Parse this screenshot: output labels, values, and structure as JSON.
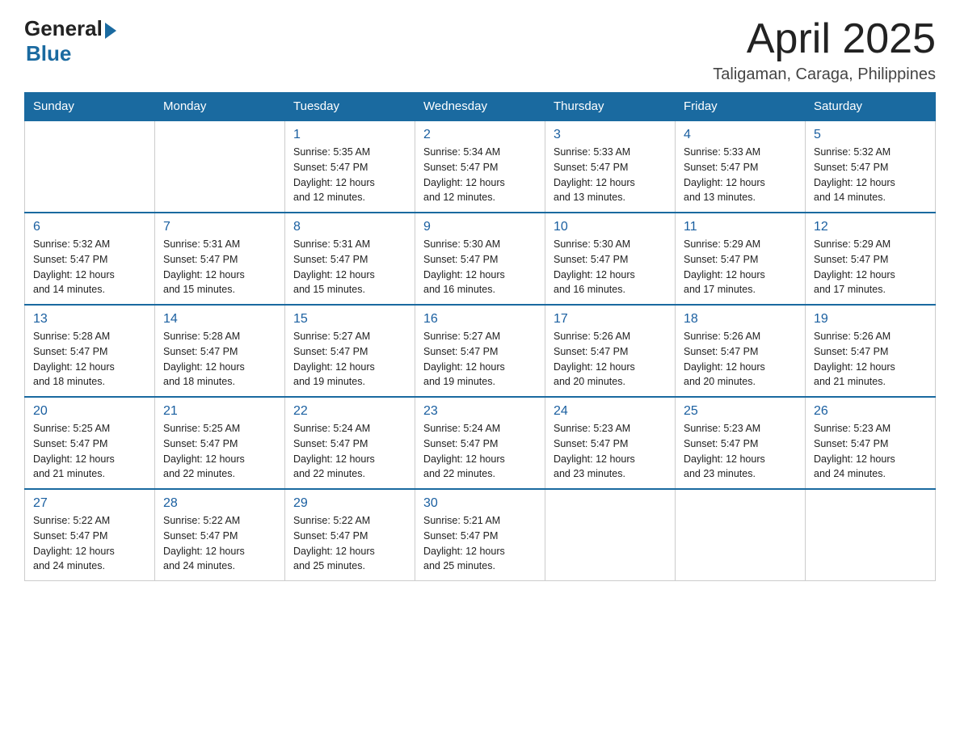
{
  "logo": {
    "general": "General",
    "blue": "Blue",
    "line2": "Blue"
  },
  "header": {
    "title": "April 2025",
    "location": "Taligaman, Caraga, Philippines"
  },
  "days_of_week": [
    "Sunday",
    "Monday",
    "Tuesday",
    "Wednesday",
    "Thursday",
    "Friday",
    "Saturday"
  ],
  "weeks": [
    [
      {
        "day": "",
        "info": ""
      },
      {
        "day": "",
        "info": ""
      },
      {
        "day": "1",
        "info": "Sunrise: 5:35 AM\nSunset: 5:47 PM\nDaylight: 12 hours\nand 12 minutes."
      },
      {
        "day": "2",
        "info": "Sunrise: 5:34 AM\nSunset: 5:47 PM\nDaylight: 12 hours\nand 12 minutes."
      },
      {
        "day": "3",
        "info": "Sunrise: 5:33 AM\nSunset: 5:47 PM\nDaylight: 12 hours\nand 13 minutes."
      },
      {
        "day": "4",
        "info": "Sunrise: 5:33 AM\nSunset: 5:47 PM\nDaylight: 12 hours\nand 13 minutes."
      },
      {
        "day": "5",
        "info": "Sunrise: 5:32 AM\nSunset: 5:47 PM\nDaylight: 12 hours\nand 14 minutes."
      }
    ],
    [
      {
        "day": "6",
        "info": "Sunrise: 5:32 AM\nSunset: 5:47 PM\nDaylight: 12 hours\nand 14 minutes."
      },
      {
        "day": "7",
        "info": "Sunrise: 5:31 AM\nSunset: 5:47 PM\nDaylight: 12 hours\nand 15 minutes."
      },
      {
        "day": "8",
        "info": "Sunrise: 5:31 AM\nSunset: 5:47 PM\nDaylight: 12 hours\nand 15 minutes."
      },
      {
        "day": "9",
        "info": "Sunrise: 5:30 AM\nSunset: 5:47 PM\nDaylight: 12 hours\nand 16 minutes."
      },
      {
        "day": "10",
        "info": "Sunrise: 5:30 AM\nSunset: 5:47 PM\nDaylight: 12 hours\nand 16 minutes."
      },
      {
        "day": "11",
        "info": "Sunrise: 5:29 AM\nSunset: 5:47 PM\nDaylight: 12 hours\nand 17 minutes."
      },
      {
        "day": "12",
        "info": "Sunrise: 5:29 AM\nSunset: 5:47 PM\nDaylight: 12 hours\nand 17 minutes."
      }
    ],
    [
      {
        "day": "13",
        "info": "Sunrise: 5:28 AM\nSunset: 5:47 PM\nDaylight: 12 hours\nand 18 minutes."
      },
      {
        "day": "14",
        "info": "Sunrise: 5:28 AM\nSunset: 5:47 PM\nDaylight: 12 hours\nand 18 minutes."
      },
      {
        "day": "15",
        "info": "Sunrise: 5:27 AM\nSunset: 5:47 PM\nDaylight: 12 hours\nand 19 minutes."
      },
      {
        "day": "16",
        "info": "Sunrise: 5:27 AM\nSunset: 5:47 PM\nDaylight: 12 hours\nand 19 minutes."
      },
      {
        "day": "17",
        "info": "Sunrise: 5:26 AM\nSunset: 5:47 PM\nDaylight: 12 hours\nand 20 minutes."
      },
      {
        "day": "18",
        "info": "Sunrise: 5:26 AM\nSunset: 5:47 PM\nDaylight: 12 hours\nand 20 minutes."
      },
      {
        "day": "19",
        "info": "Sunrise: 5:26 AM\nSunset: 5:47 PM\nDaylight: 12 hours\nand 21 minutes."
      }
    ],
    [
      {
        "day": "20",
        "info": "Sunrise: 5:25 AM\nSunset: 5:47 PM\nDaylight: 12 hours\nand 21 minutes."
      },
      {
        "day": "21",
        "info": "Sunrise: 5:25 AM\nSunset: 5:47 PM\nDaylight: 12 hours\nand 22 minutes."
      },
      {
        "day": "22",
        "info": "Sunrise: 5:24 AM\nSunset: 5:47 PM\nDaylight: 12 hours\nand 22 minutes."
      },
      {
        "day": "23",
        "info": "Sunrise: 5:24 AM\nSunset: 5:47 PM\nDaylight: 12 hours\nand 22 minutes."
      },
      {
        "day": "24",
        "info": "Sunrise: 5:23 AM\nSunset: 5:47 PM\nDaylight: 12 hours\nand 23 minutes."
      },
      {
        "day": "25",
        "info": "Sunrise: 5:23 AM\nSunset: 5:47 PM\nDaylight: 12 hours\nand 23 minutes."
      },
      {
        "day": "26",
        "info": "Sunrise: 5:23 AM\nSunset: 5:47 PM\nDaylight: 12 hours\nand 24 minutes."
      }
    ],
    [
      {
        "day": "27",
        "info": "Sunrise: 5:22 AM\nSunset: 5:47 PM\nDaylight: 12 hours\nand 24 minutes."
      },
      {
        "day": "28",
        "info": "Sunrise: 5:22 AM\nSunset: 5:47 PM\nDaylight: 12 hours\nand 24 minutes."
      },
      {
        "day": "29",
        "info": "Sunrise: 5:22 AM\nSunset: 5:47 PM\nDaylight: 12 hours\nand 25 minutes."
      },
      {
        "day": "30",
        "info": "Sunrise: 5:21 AM\nSunset: 5:47 PM\nDaylight: 12 hours\nand 25 minutes."
      },
      {
        "day": "",
        "info": ""
      },
      {
        "day": "",
        "info": ""
      },
      {
        "day": "",
        "info": ""
      }
    ]
  ]
}
